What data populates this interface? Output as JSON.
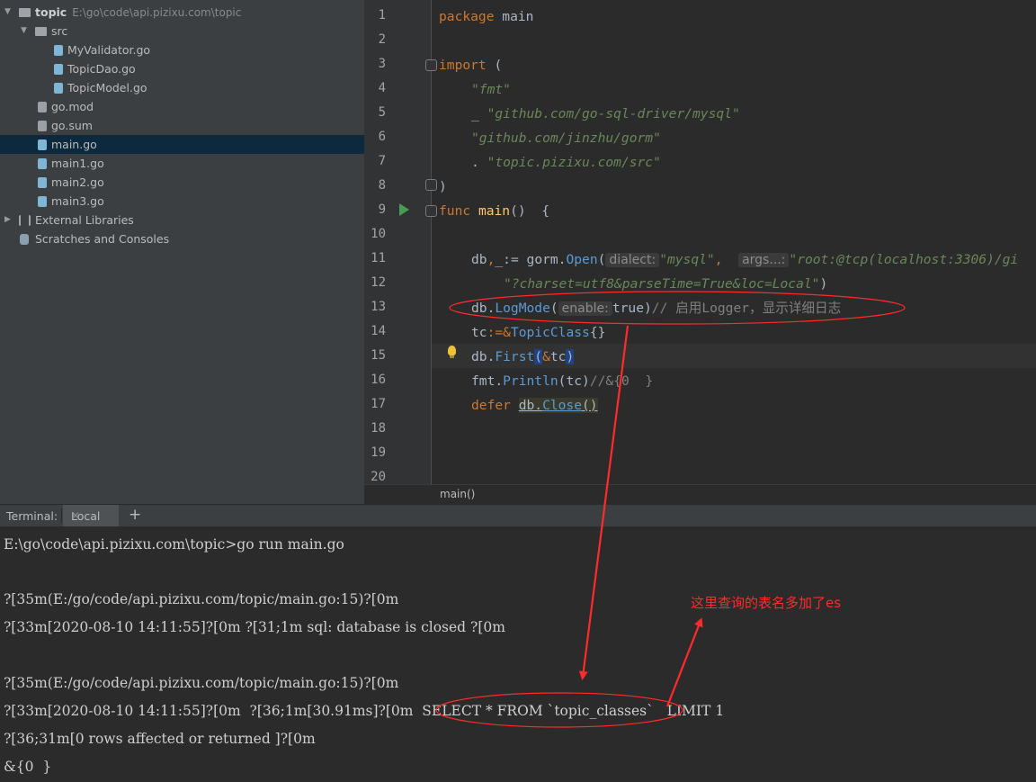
{
  "project_tree": {
    "root": {
      "name": "topic",
      "path": "E:\\go\\code\\api.pizixu.com\\topic"
    },
    "items": [
      {
        "label": "src",
        "icon": "folder-icon"
      },
      {
        "label": "MyValidator.go",
        "icon": "go-file-icon"
      },
      {
        "label": "TopicDao.go",
        "icon": "go-file-icon"
      },
      {
        "label": "TopicModel.go",
        "icon": "go-file-icon"
      },
      {
        "label": "go.mod",
        "icon": "mod-file-icon"
      },
      {
        "label": "go.sum",
        "icon": "sum-file-icon"
      },
      {
        "label": "main.go",
        "icon": "go-file-icon"
      },
      {
        "label": "main1.go",
        "icon": "go-file-icon"
      },
      {
        "label": "main2.go",
        "icon": "go-file-icon"
      },
      {
        "label": "main3.go",
        "icon": "go-file-icon"
      },
      {
        "label": "External Libraries",
        "icon": "library-icon"
      },
      {
        "label": "Scratches and Consoles",
        "icon": "scratch-icon"
      }
    ]
  },
  "editor": {
    "line_numbers": [
      "1",
      "2",
      "3",
      "4",
      "5",
      "6",
      "7",
      "8",
      "9",
      "10",
      "11",
      "12",
      "13",
      "14",
      "15",
      "16",
      "17",
      "18",
      "19",
      "20"
    ],
    "code": {
      "l1_kw": "package",
      "l1_rest": " main",
      "l3_kw": "import",
      "l3_rest": " (",
      "l4": "\"fmt\"",
      "l5_a": "_ ",
      "l5_b": "\"github.com/go-sql-driver/mysql\"",
      "l6": "\"github.com/jinzhu/gorm\"",
      "l7_a": ". ",
      "l7_b": "\"topic.pizixu.com/src\"",
      "l8": ")",
      "l9_kw": "func",
      "l9_fn": " main",
      "l9_rest": "()  {",
      "l11_a": "db",
      "l11_b": ",",
      "l11_c": "_",
      "l11_d": ":= gorm.",
      "l11_e": "Open",
      "l11_f": "(",
      "l11_hint1": "dialect:",
      "l11_g": "\"mysql\"",
      "l11_h": ",  ",
      "l11_hint2": "args...:",
      "l11_i": "\"root:@tcp(localhost:3306)/gi",
      "l12": "\"?charset=utf8&parseTime=True&loc=Local\"",
      "l12_end": ")",
      "l13_a": "db.",
      "l13_b": "LogMode",
      "l13_c": "(",
      "l13_hint": "enable:",
      "l13_d": "true)",
      "l13_cm": "// 启用Logger，显示详细日志",
      "l14_a": "tc",
      "l14_b": ":=&",
      "l14_c": "TopicClass",
      "l14_d": "{}",
      "l15_a": "db.",
      "l15_b": "First",
      "l15_c": "(",
      "l15_d": "&",
      "l15_e": "tc",
      "l15_f": ")",
      "l16_a": "fmt.",
      "l16_b": "Println",
      "l16_c": "(tc)",
      "l16_cm": "//&{0  }",
      "l17_kw": "defer ",
      "l17_a": "db.",
      "l17_b": "Close",
      "l17_c": "()"
    },
    "breadcrumb": "main()"
  },
  "terminal": {
    "label": "Terminal:",
    "tab": "Local",
    "lines": [
      "E:\\go\\code\\api.pizixu.com\\topic>go run main.go",
      "?[35m(E:/go/code/api.pizixu.com/topic/main.go:15)?[0m",
      "?[33m[2020-08-10 14:11:55]?[0m ?[31;1m sql: database is closed ?[0m",
      "?[35m(E:/go/code/api.pizixu.com/topic/main.go:15)?[0m",
      "?[33m[2020-08-10 14:11:55]?[0m  ?[36;1m[30.91ms]?[0m  SELECT * FROM `topic_classes`   LIMIT 1",
      "?[36;31m[0 rows affected or returned ]?[0m",
      "&{0  }"
    ]
  },
  "annotation": {
    "text": "这里查询的表名多加了es",
    "color": "#ff2b2b"
  }
}
